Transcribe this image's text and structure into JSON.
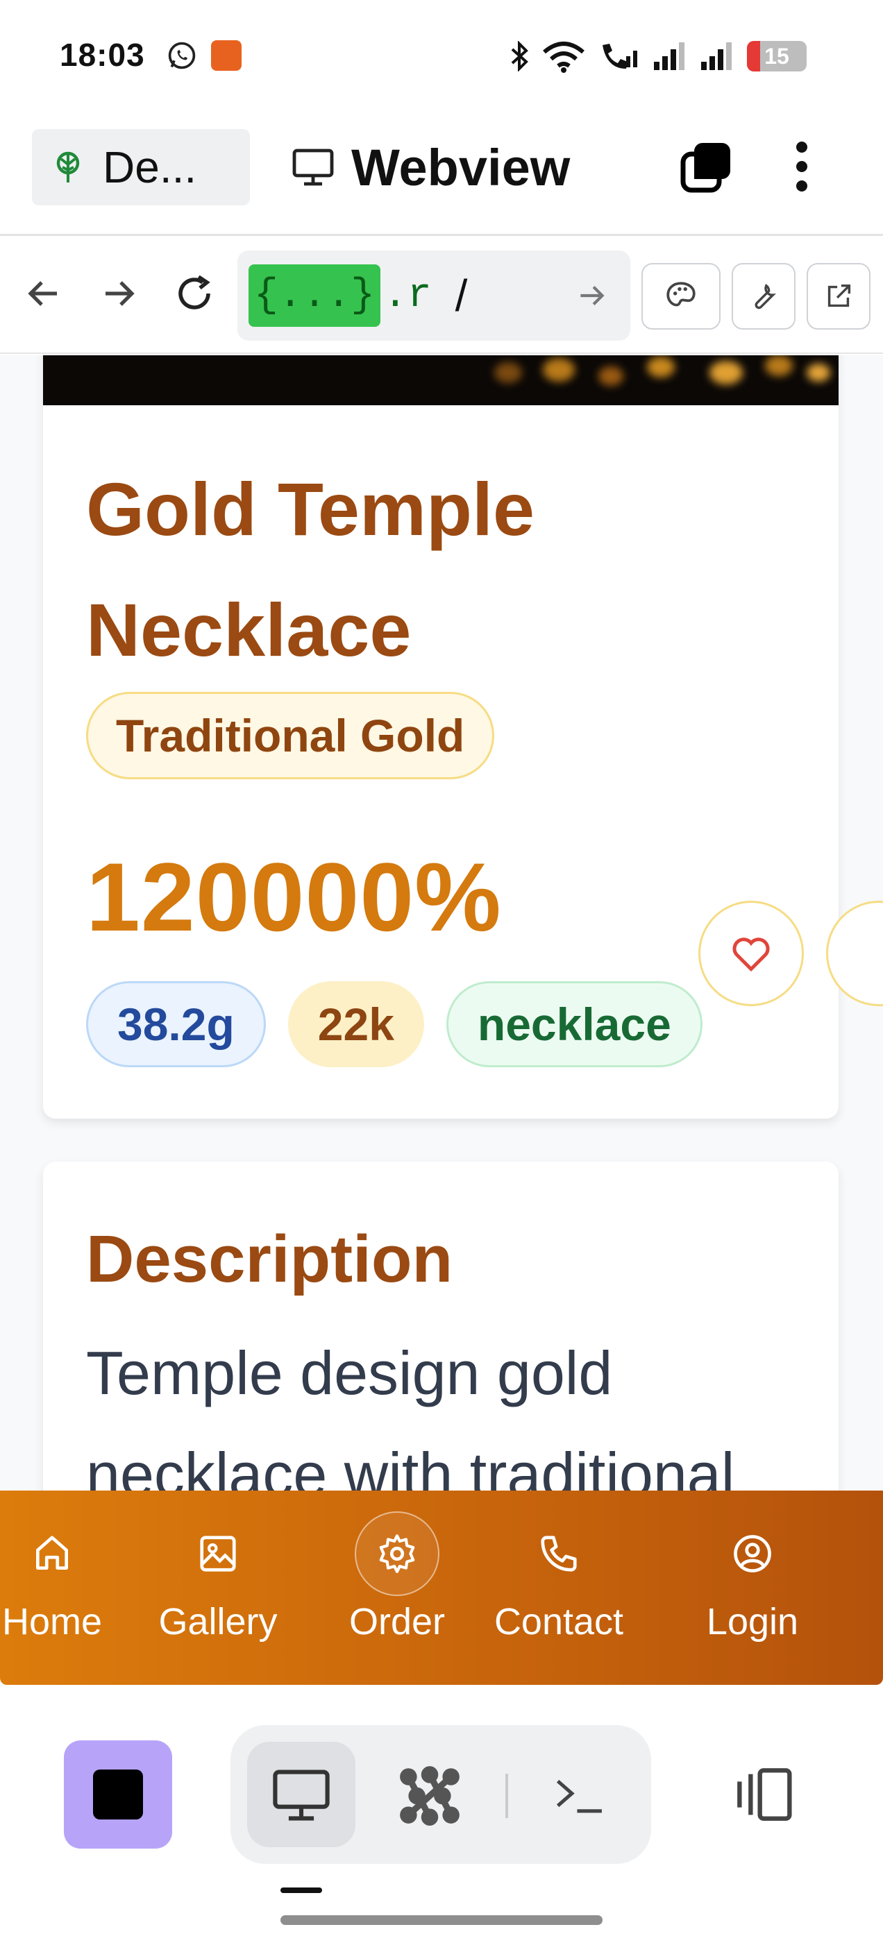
{
  "status_bar": {
    "time": "18:03",
    "battery_level": "15",
    "icons": [
      "whatsapp-icon",
      "adobe-app-icon",
      "bluetooth-icon",
      "wifi-icon",
      "wifi-calling-icon",
      "signal-icon",
      "signal-icon",
      "battery-icon"
    ]
  },
  "tab_header": {
    "tab_label": "De...",
    "title": "Webview"
  },
  "browser": {
    "url_highlight": "{...}",
    "url_suffix": ".r",
    "url_path": "/"
  },
  "product": {
    "title": "Gold Temple Necklace",
    "category": "Traditional Gold",
    "price": "120000%",
    "weight": "38.2g",
    "karat": "22k",
    "type": "necklace"
  },
  "description": {
    "heading": "Description",
    "text": "Temple design gold necklace with traditional"
  },
  "bottom_nav": {
    "items": [
      {
        "label": "Home",
        "icon": "home-icon"
      },
      {
        "label": "Gallery",
        "icon": "image-icon"
      },
      {
        "label": "Order",
        "icon": "gear-icon"
      },
      {
        "label": "Contact",
        "icon": "phone-icon"
      },
      {
        "label": "Login",
        "icon": "user-circle-icon"
      }
    ]
  },
  "colors": {
    "brand_brown": "#9a4a12",
    "price_orange": "#d47a0e",
    "nav_gradient_start": "#dc7c0c",
    "nav_gradient_end": "#b4520c",
    "url_highlight": "#36c24e"
  }
}
